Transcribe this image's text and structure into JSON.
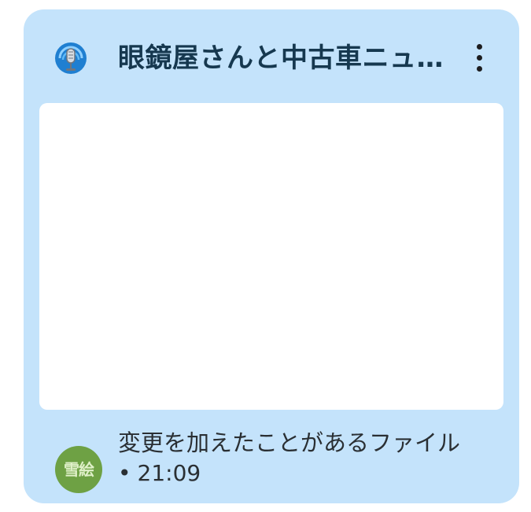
{
  "widget": {
    "title": "眼鏡屋さんと中古車ニュ…",
    "app_icon": "podcast-microphone-icon",
    "menu_icon": "more-vert-icon",
    "background_color": "#c4e3fb",
    "title_color": "#16384f"
  },
  "preview": {
    "background_color": "#ffffff"
  },
  "footer": {
    "avatar_text": "雪絵",
    "avatar_color": "#6ea144",
    "status_text": "変更を加えたことがあるファイル",
    "bullet": "•",
    "time": "21:09"
  }
}
